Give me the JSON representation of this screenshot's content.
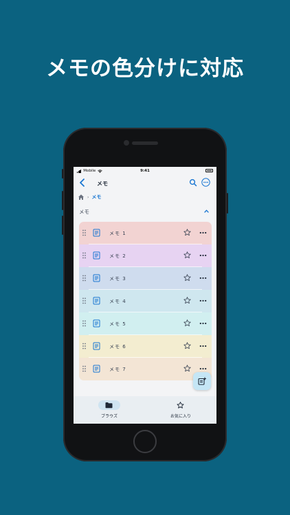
{
  "headline": "メモの色分けに対応",
  "status": {
    "carrier": "Mobile",
    "time": "9:41"
  },
  "nav": {
    "title": "メモ",
    "back_icon": "chevron-left-icon",
    "search_icon": "search-icon",
    "more_icon": "more-circle-icon"
  },
  "breadcrumb": {
    "home_icon": "home-icon",
    "separator": "›",
    "current": "メモ"
  },
  "section": {
    "label": "メモ",
    "toggle_icon": "chevron-up-icon"
  },
  "memos": [
    {
      "title": "メモ 1",
      "color": "#f2d3d2"
    },
    {
      "title": "メモ 2",
      "color": "#e7d3f2"
    },
    {
      "title": "メモ 3",
      "color": "#cfdcee"
    },
    {
      "title": "メモ 4",
      "color": "#cfe7ef"
    },
    {
      "title": "メモ 5",
      "color": "#d1eff0"
    },
    {
      "title": "メモ 6",
      "color": "#f3edd0"
    },
    {
      "title": "メモ 7",
      "color": "#f3e5d5"
    }
  ],
  "fab": {
    "icon": "new-note-icon"
  },
  "tabs": [
    {
      "label": "ブラウズ",
      "icon": "folder-icon",
      "selected": true
    },
    {
      "label": "お気に入り",
      "icon": "star-icon",
      "selected": false
    }
  ],
  "colors": {
    "background": "#0b6280",
    "accent": "#1976d2",
    "screen": "#f3f4f6"
  }
}
